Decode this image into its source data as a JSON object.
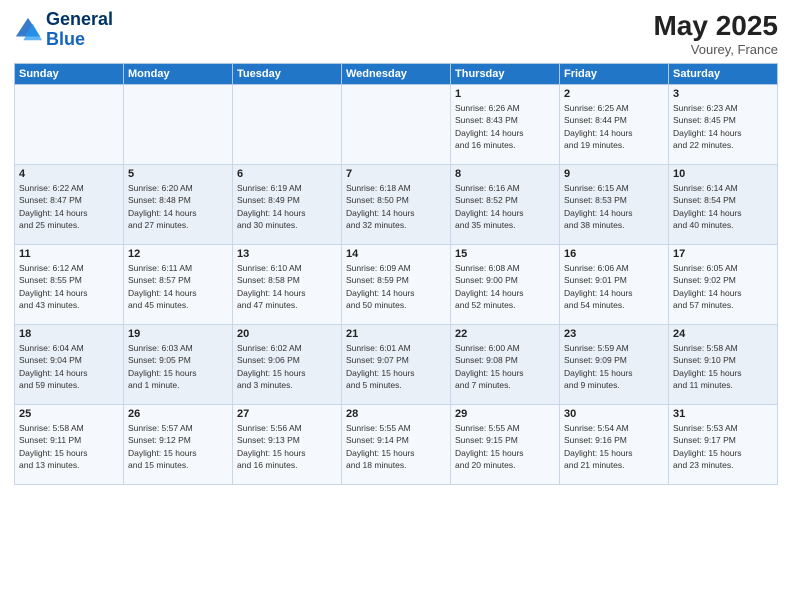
{
  "header": {
    "logo_line1": "General",
    "logo_line2": "Blue",
    "month": "May 2025",
    "location": "Vourey, France"
  },
  "weekdays": [
    "Sunday",
    "Monday",
    "Tuesday",
    "Wednesday",
    "Thursday",
    "Friday",
    "Saturday"
  ],
  "weeks": [
    [
      {
        "day": "",
        "info": ""
      },
      {
        "day": "",
        "info": ""
      },
      {
        "day": "",
        "info": ""
      },
      {
        "day": "",
        "info": ""
      },
      {
        "day": "1",
        "info": "Sunrise: 6:26 AM\nSunset: 8:43 PM\nDaylight: 14 hours\nand 16 minutes."
      },
      {
        "day": "2",
        "info": "Sunrise: 6:25 AM\nSunset: 8:44 PM\nDaylight: 14 hours\nand 19 minutes."
      },
      {
        "day": "3",
        "info": "Sunrise: 6:23 AM\nSunset: 8:45 PM\nDaylight: 14 hours\nand 22 minutes."
      }
    ],
    [
      {
        "day": "4",
        "info": "Sunrise: 6:22 AM\nSunset: 8:47 PM\nDaylight: 14 hours\nand 25 minutes."
      },
      {
        "day": "5",
        "info": "Sunrise: 6:20 AM\nSunset: 8:48 PM\nDaylight: 14 hours\nand 27 minutes."
      },
      {
        "day": "6",
        "info": "Sunrise: 6:19 AM\nSunset: 8:49 PM\nDaylight: 14 hours\nand 30 minutes."
      },
      {
        "day": "7",
        "info": "Sunrise: 6:18 AM\nSunset: 8:50 PM\nDaylight: 14 hours\nand 32 minutes."
      },
      {
        "day": "8",
        "info": "Sunrise: 6:16 AM\nSunset: 8:52 PM\nDaylight: 14 hours\nand 35 minutes."
      },
      {
        "day": "9",
        "info": "Sunrise: 6:15 AM\nSunset: 8:53 PM\nDaylight: 14 hours\nand 38 minutes."
      },
      {
        "day": "10",
        "info": "Sunrise: 6:14 AM\nSunset: 8:54 PM\nDaylight: 14 hours\nand 40 minutes."
      }
    ],
    [
      {
        "day": "11",
        "info": "Sunrise: 6:12 AM\nSunset: 8:55 PM\nDaylight: 14 hours\nand 43 minutes."
      },
      {
        "day": "12",
        "info": "Sunrise: 6:11 AM\nSunset: 8:57 PM\nDaylight: 14 hours\nand 45 minutes."
      },
      {
        "day": "13",
        "info": "Sunrise: 6:10 AM\nSunset: 8:58 PM\nDaylight: 14 hours\nand 47 minutes."
      },
      {
        "day": "14",
        "info": "Sunrise: 6:09 AM\nSunset: 8:59 PM\nDaylight: 14 hours\nand 50 minutes."
      },
      {
        "day": "15",
        "info": "Sunrise: 6:08 AM\nSunset: 9:00 PM\nDaylight: 14 hours\nand 52 minutes."
      },
      {
        "day": "16",
        "info": "Sunrise: 6:06 AM\nSunset: 9:01 PM\nDaylight: 14 hours\nand 54 minutes."
      },
      {
        "day": "17",
        "info": "Sunrise: 6:05 AM\nSunset: 9:02 PM\nDaylight: 14 hours\nand 57 minutes."
      }
    ],
    [
      {
        "day": "18",
        "info": "Sunrise: 6:04 AM\nSunset: 9:04 PM\nDaylight: 14 hours\nand 59 minutes."
      },
      {
        "day": "19",
        "info": "Sunrise: 6:03 AM\nSunset: 9:05 PM\nDaylight: 15 hours\nand 1 minute."
      },
      {
        "day": "20",
        "info": "Sunrise: 6:02 AM\nSunset: 9:06 PM\nDaylight: 15 hours\nand 3 minutes."
      },
      {
        "day": "21",
        "info": "Sunrise: 6:01 AM\nSunset: 9:07 PM\nDaylight: 15 hours\nand 5 minutes."
      },
      {
        "day": "22",
        "info": "Sunrise: 6:00 AM\nSunset: 9:08 PM\nDaylight: 15 hours\nand 7 minutes."
      },
      {
        "day": "23",
        "info": "Sunrise: 5:59 AM\nSunset: 9:09 PM\nDaylight: 15 hours\nand 9 minutes."
      },
      {
        "day": "24",
        "info": "Sunrise: 5:58 AM\nSunset: 9:10 PM\nDaylight: 15 hours\nand 11 minutes."
      }
    ],
    [
      {
        "day": "25",
        "info": "Sunrise: 5:58 AM\nSunset: 9:11 PM\nDaylight: 15 hours\nand 13 minutes."
      },
      {
        "day": "26",
        "info": "Sunrise: 5:57 AM\nSunset: 9:12 PM\nDaylight: 15 hours\nand 15 minutes."
      },
      {
        "day": "27",
        "info": "Sunrise: 5:56 AM\nSunset: 9:13 PM\nDaylight: 15 hours\nand 16 minutes."
      },
      {
        "day": "28",
        "info": "Sunrise: 5:55 AM\nSunset: 9:14 PM\nDaylight: 15 hours\nand 18 minutes."
      },
      {
        "day": "29",
        "info": "Sunrise: 5:55 AM\nSunset: 9:15 PM\nDaylight: 15 hours\nand 20 minutes."
      },
      {
        "day": "30",
        "info": "Sunrise: 5:54 AM\nSunset: 9:16 PM\nDaylight: 15 hours\nand 21 minutes."
      },
      {
        "day": "31",
        "info": "Sunrise: 5:53 AM\nSunset: 9:17 PM\nDaylight: 15 hours\nand 23 minutes."
      }
    ]
  ]
}
